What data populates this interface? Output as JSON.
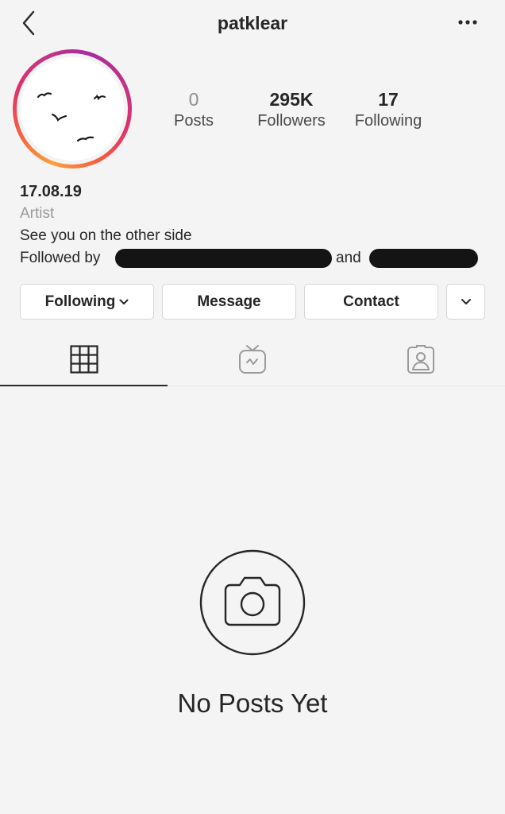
{
  "header": {
    "username": "patklear",
    "back_icon": "chevron-left-icon",
    "more_icon": "more-horizontal-icon"
  },
  "profile": {
    "avatar": "avatar-birds",
    "stats": {
      "posts": {
        "value": "0",
        "label": "Posts"
      },
      "followers": {
        "value": "295K",
        "label": "Followers"
      },
      "following": {
        "value": "17",
        "label": "Following"
      }
    },
    "name": "17.08.19",
    "category": "Artist",
    "bio": "See you on the other side",
    "followed_by": {
      "prefix": "Followed by",
      "joiner": "and"
    }
  },
  "actions": {
    "following_label": "Following",
    "message_label": "Message",
    "contact_label": "Contact",
    "more_icon": "chevron-down-icon"
  },
  "tabs": [
    {
      "icon": "grid-icon",
      "active": true
    },
    {
      "icon": "igtv-icon",
      "active": false
    },
    {
      "icon": "tagged-icon",
      "active": false
    }
  ],
  "empty_state": {
    "icon": "camera-icon",
    "text": "No Posts Yet"
  },
  "colors": {
    "background": "#f4f4f4",
    "text": "#262626",
    "muted": "#8e8e8e",
    "ring_start": "#f9a13b",
    "ring_end": "#c13584"
  }
}
